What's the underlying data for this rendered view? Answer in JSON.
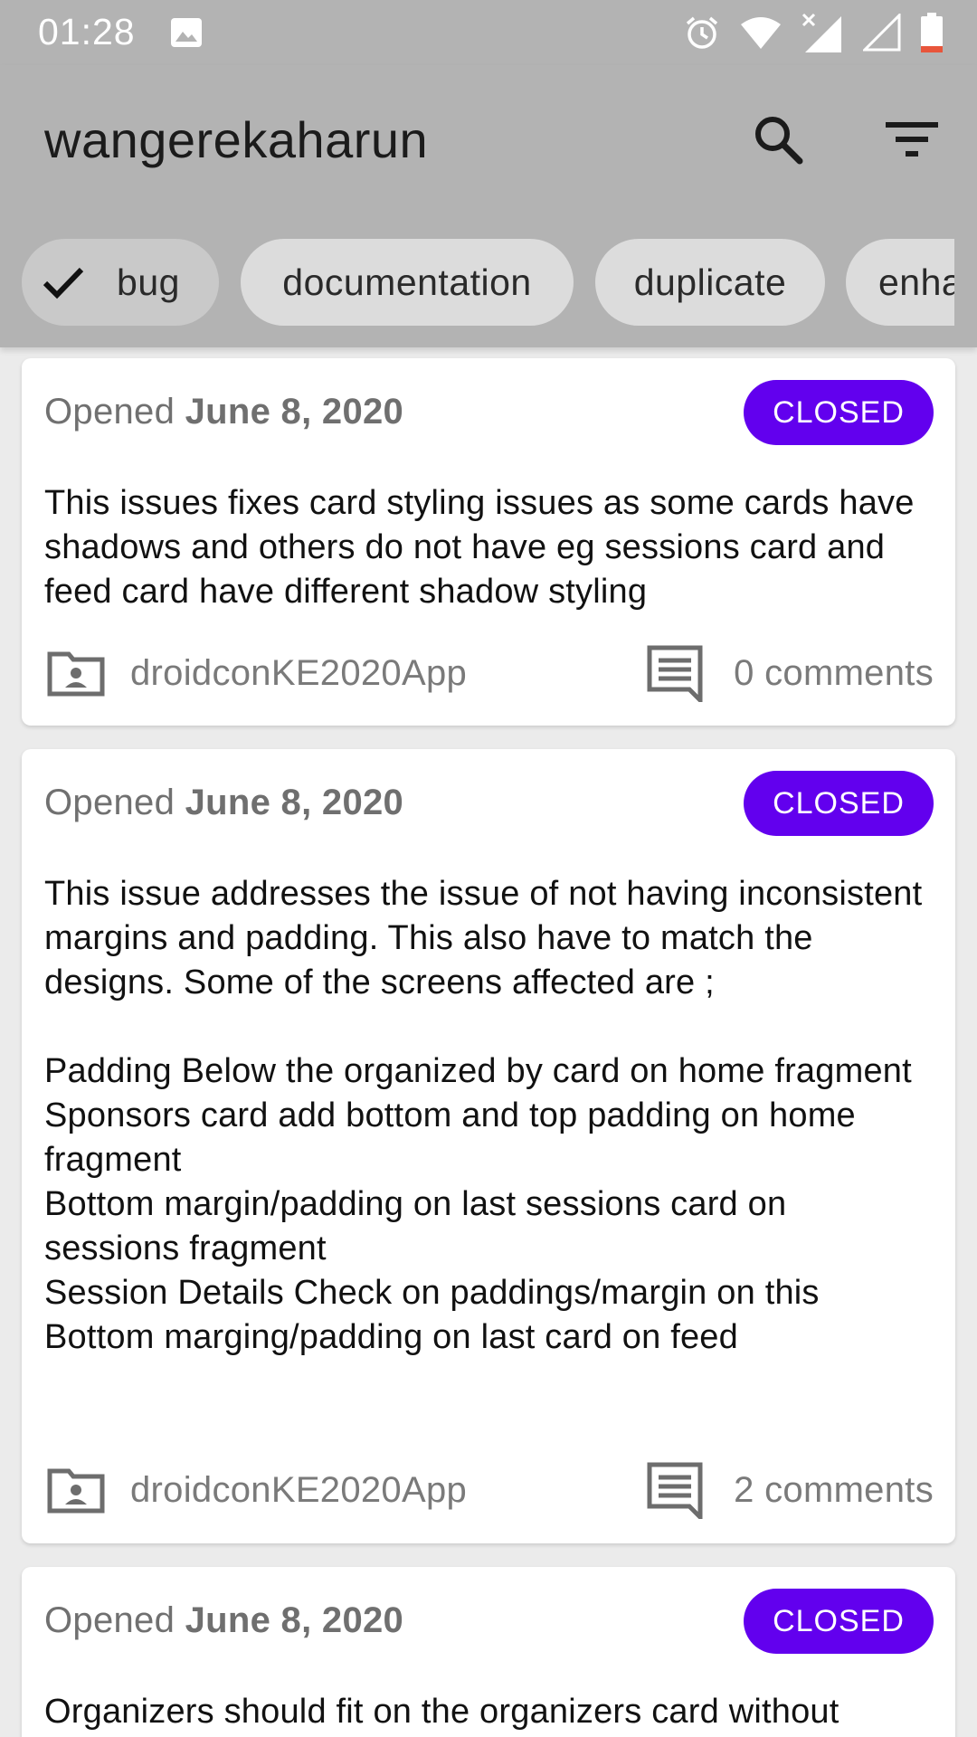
{
  "status_bar": {
    "time": "01:28",
    "icons": [
      "image-icon",
      "alarm-icon",
      "wifi-icon",
      "cell-signal-x-icon",
      "cell-signal-empty-icon",
      "battery-low-icon"
    ]
  },
  "app_bar": {
    "title": "wangerekaharun",
    "actions": [
      "search-icon",
      "filter-icon"
    ]
  },
  "chips": [
    {
      "label": "bug",
      "selected": true
    },
    {
      "label": "documentation",
      "selected": false
    },
    {
      "label": "duplicate",
      "selected": false
    },
    {
      "label": "enha",
      "selected": false
    }
  ],
  "colors": {
    "badge": "#6200ee",
    "scrim": "#b3b3b3"
  },
  "issues": [
    {
      "opened_prefix": "Opened",
      "date": "June 8, 2020",
      "status": "CLOSED",
      "body": "This issues fixes card styling issues as some  cards have shadows and others do not have eg sessions card and feed card have different shadow styling",
      "repo": "droidconKE2020App",
      "comments": "0 comments"
    },
    {
      "opened_prefix": "Opened",
      "date": "June 8, 2020",
      "status": "CLOSED",
      "body": "This issue addresses the issue of not having inconsistent margins and padding. This also have to match the designs. Some of the screens affected are ;\n\nPadding Below the organized by card on home fragment\nSponsors card add bottom and top padding on home fragment\nBottom margin/padding on last sessions card on sessions fragment\nSession Details Check on paddings/margin on this\nBottom marging/padding on last card on feed",
      "repo": "droidconKE2020App",
      "comments": "2 comments"
    },
    {
      "opened_prefix": "Opened",
      "date": "June 8, 2020",
      "status": "CLOSED",
      "body": "Organizers should fit on the organizers card without"
    }
  ]
}
